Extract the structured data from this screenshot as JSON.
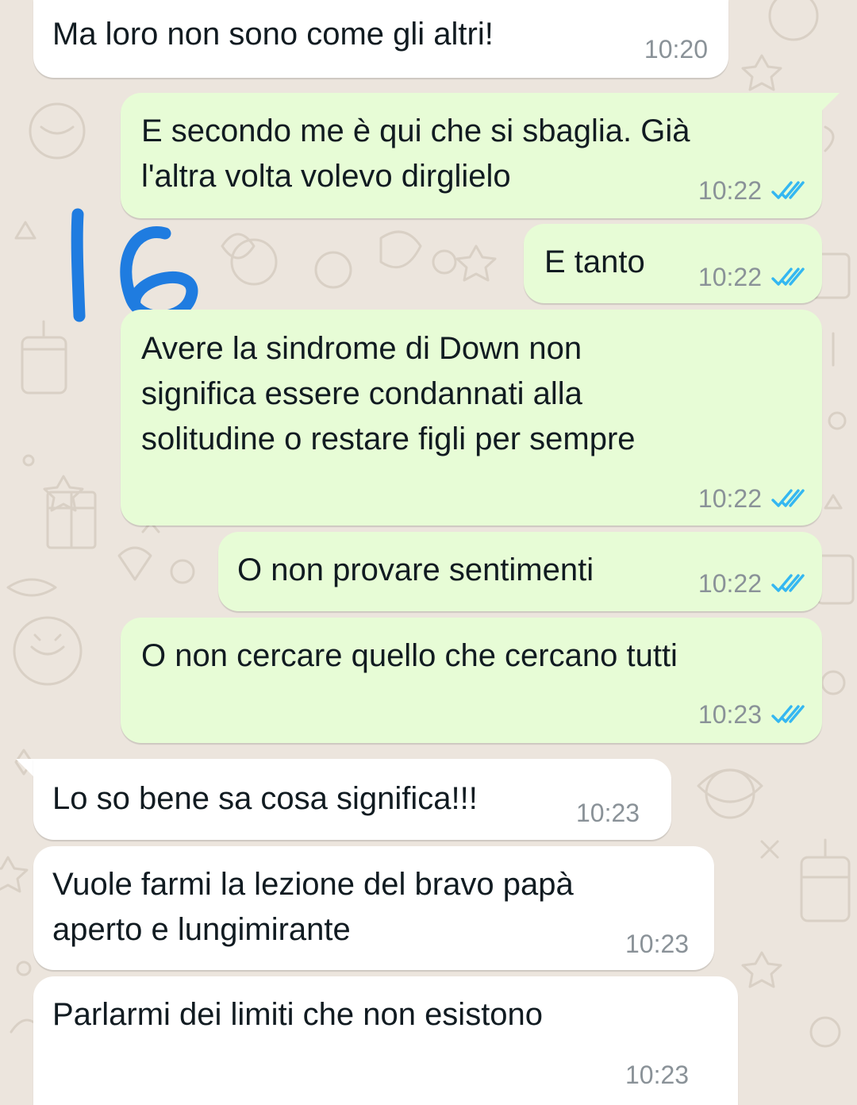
{
  "colors": {
    "wallpaper": "#ece5dd",
    "incoming_bubble": "#ffffff",
    "outgoing_bubble": "#e7fcd6",
    "read_ticks": "#34b7f1",
    "annotation_ink": "#1f7ce0"
  },
  "annotation": {
    "handwritten_number": "16"
  },
  "messages": [
    {
      "direction": "incoming",
      "text": "Ma loro non sono come gli altri!",
      "time": "10:20",
      "status": ""
    },
    {
      "direction": "outgoing",
      "text": "E secondo me è qui che si sbaglia. Già\nl'altra volta volevo dirglielo",
      "time": "10:22",
      "status": "read"
    },
    {
      "direction": "outgoing",
      "text": "E tanto",
      "time": "10:22",
      "status": "read"
    },
    {
      "direction": "outgoing",
      "text": "Avere la sindrome di Down non\nsignifica essere condannati alla\nsolitudine o restare figli per sempre",
      "time": "10:22",
      "status": "read"
    },
    {
      "direction": "outgoing",
      "text": "O non provare sentimenti",
      "time": "10:22",
      "status": "read"
    },
    {
      "direction": "outgoing",
      "text": "O non cercare quello che cercano tutti",
      "time": "10:23",
      "status": "read"
    },
    {
      "direction": "incoming",
      "text": "Lo so bene sa cosa significa!!!",
      "time": "10:23",
      "status": ""
    },
    {
      "direction": "incoming",
      "text": "Vuole farmi la lezione del bravo papà\naperto e lungimirante",
      "time": "10:23",
      "status": ""
    },
    {
      "direction": "incoming",
      "text": "Parlarmi dei limiti che non esistono",
      "time": "10:23",
      "status": ""
    }
  ]
}
